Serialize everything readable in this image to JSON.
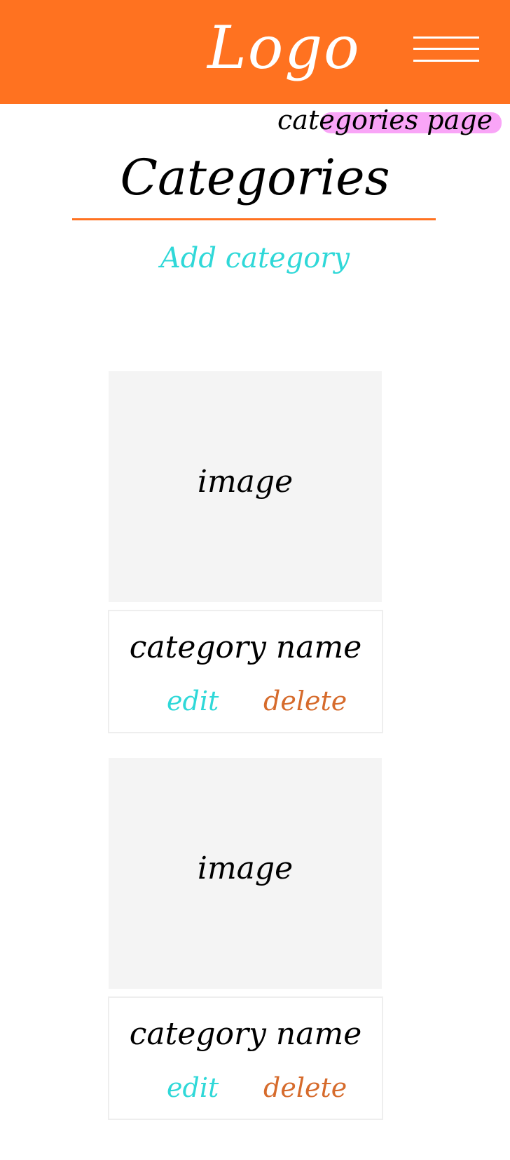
{
  "colors": {
    "header_bg": "#ff7220",
    "accent_orange": "#ff7220",
    "highlight_pink": "#f9a5f7",
    "link_cyan": "#2fd8d8",
    "delete_orange": "#d66b2c",
    "placeholder_gray": "#f4f4f4"
  },
  "header": {
    "logo": "Logo",
    "menu_icon": "hamburger-menu-icon"
  },
  "page_label": "categories page",
  "page_title": "Categories",
  "add_category_label": "Add category",
  "categories": [
    {
      "image_label": "image",
      "name": "category name",
      "edit_label": "edit",
      "delete_label": "delete"
    },
    {
      "image_label": "image",
      "name": "category name",
      "edit_label": "edit",
      "delete_label": "delete"
    }
  ]
}
